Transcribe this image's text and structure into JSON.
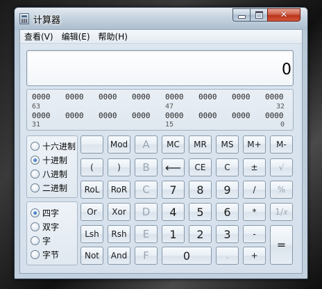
{
  "window": {
    "title": "计算器",
    "close_glyph": "✕"
  },
  "menu": [
    "查看(V)",
    "编辑(E)",
    "帮助(H)"
  ],
  "display": {
    "value": "0"
  },
  "bits": {
    "row1": [
      "0000",
      "0000",
      "0000",
      "0000",
      "0000",
      "0000",
      "0000",
      "0000"
    ],
    "row1_idx": [
      "63",
      "47",
      "32"
    ],
    "row2": [
      "0000",
      "0000",
      "0000",
      "0000",
      "0000",
      "0000",
      "0000",
      "0000"
    ],
    "row2_idx": [
      "31",
      "15",
      "0"
    ]
  },
  "base_options": [
    {
      "label": "十六进制",
      "selected": false
    },
    {
      "label": "十进制",
      "selected": true
    },
    {
      "label": "八进制",
      "selected": false
    },
    {
      "label": "二进制",
      "selected": false
    }
  ],
  "word_options": [
    {
      "label": "四字",
      "selected": true
    },
    {
      "label": "双字",
      "selected": false
    },
    {
      "label": "字",
      "selected": false
    },
    {
      "label": "字节",
      "selected": false
    }
  ],
  "keys": {
    "blank": "",
    "mod": "Mod",
    "a": "A",
    "mc": "MC",
    "mr": "MR",
    "ms": "MS",
    "mplus": "M+",
    "mminus": "M-",
    "lparen": "(",
    "rparen": ")",
    "b": "B",
    "back": "⟵",
    "ce": "CE",
    "c": "C",
    "pm": "±",
    "sqrt": "√",
    "rol": "RoL",
    "ror": "RoR",
    "cc": "C",
    "n7": "7",
    "n8": "8",
    "n9": "9",
    "div": "/",
    "pct": "%",
    "or": "Or",
    "xor": "Xor",
    "d": "D",
    "n4": "4",
    "n5": "5",
    "n6": "6",
    "mul": "*",
    "recip": "1/𝑥",
    "lsh": "Lsh",
    "rsh": "Rsh",
    "e": "E",
    "n1": "1",
    "n2": "2",
    "n3": "3",
    "sub": "-",
    "eq": "=",
    "not": "Not",
    "and": "And",
    "f": "F",
    "n0": "0",
    "dot": ".",
    "add": "+"
  }
}
